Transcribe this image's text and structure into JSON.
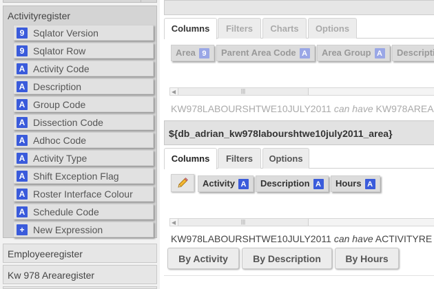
{
  "left": {
    "group_title": "Activityregister",
    "fields": [
      {
        "label": "Sqlator Version",
        "type": "9",
        "icon": "number-type-icon"
      },
      {
        "label": "Sqlator Row",
        "type": "9",
        "icon": "number-type-icon"
      },
      {
        "label": "Activity Code",
        "type": "A",
        "icon": "text-type-icon"
      },
      {
        "label": "Description",
        "type": "A",
        "icon": "text-type-icon"
      },
      {
        "label": "Group Code",
        "type": "A",
        "icon": "text-type-icon"
      },
      {
        "label": "Dissection Code",
        "type": "A",
        "icon": "text-type-icon"
      },
      {
        "label": "Adhoc Code",
        "type": "A",
        "icon": "text-type-icon"
      },
      {
        "label": "Activity Type",
        "type": "A",
        "icon": "text-type-icon"
      },
      {
        "label": "Shift Exception Flag",
        "type": "A",
        "icon": "text-type-icon"
      },
      {
        "label": "Roster Interface Colour",
        "type": "A",
        "icon": "text-type-icon"
      },
      {
        "label": "Schedule Code",
        "type": "A",
        "icon": "text-type-icon"
      },
      {
        "label": "New Expression",
        "type": "+",
        "icon": "plus-icon"
      }
    ],
    "sections": [
      "Employeeregister",
      "Kw 978 Arearegister"
    ]
  },
  "panel1": {
    "tabs": [
      "Columns",
      "Filters",
      "Charts",
      "Options"
    ],
    "active_tab": "Columns",
    "chips": [
      {
        "label": "Area",
        "type": "9"
      },
      {
        "label": "Parent Area Code",
        "type": "A"
      },
      {
        "label": "Area Group",
        "type": "A"
      },
      {
        "label": "Descriptio",
        "type": ""
      }
    ],
    "relation": {
      "table": "KW978LABOURSHTWE10JULY2011",
      "verb": "can have",
      "target": "KW978AREA"
    }
  },
  "panel2": {
    "title": "${db_adrian_kw978labourshtwe10july2011_area}",
    "tabs": [
      "Columns",
      "Filters",
      "Options"
    ],
    "active_tab": "Columns",
    "chips": [
      {
        "label": "Activity",
        "type": "A"
      },
      {
        "label": "Description",
        "type": "A"
      },
      {
        "label": "Hours",
        "type": "A"
      }
    ],
    "relation": {
      "table": "KW978LABOURSHTWE10JULY2011",
      "verb": "can have",
      "target": "ACTIVITYRE"
    },
    "sort_buttons": [
      "By Activity",
      "By Description",
      "By Hours"
    ]
  },
  "icons": {
    "edit": "pencil-icon",
    "scroll_left": "arrow-left-icon",
    "scroll_grip": "grip-icon"
  },
  "colors": {
    "type_icon": "#3a5bdb",
    "type_icon_faded": "#9aa7e6"
  }
}
